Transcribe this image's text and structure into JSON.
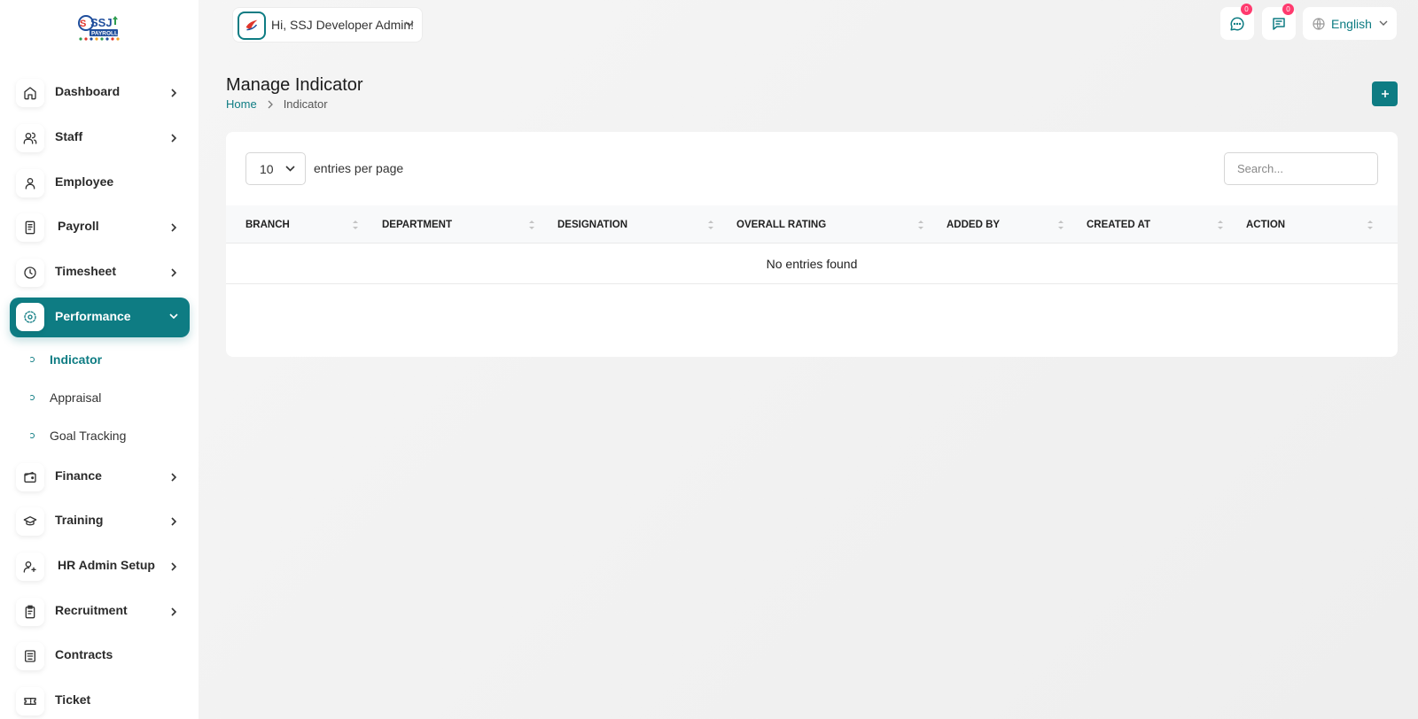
{
  "brand": {
    "logo_text": "SSJ PAYROLL",
    "accent": "#0e7c83"
  },
  "header": {
    "greeting": "Hi, SSJ Developer Admin!",
    "messages_badge": "0",
    "notifications_badge": "0",
    "language": "English"
  },
  "sidebar": {
    "items": [
      {
        "label": "Dashboard",
        "icon": "home-icon",
        "has_children": true
      },
      {
        "label": "Staff",
        "icon": "users-icon",
        "has_children": true
      },
      {
        "label": "Employee",
        "icon": "user-icon",
        "has_children": false
      },
      {
        "label": "Payroll",
        "icon": "receipt-icon",
        "has_children": true
      },
      {
        "label": "Timesheet",
        "icon": "clock-icon",
        "has_children": true
      },
      {
        "label": "Performance",
        "icon": "performance-icon",
        "has_children": true,
        "expanded": true
      },
      {
        "label": "Finance",
        "icon": "wallet-icon",
        "has_children": true
      },
      {
        "label": "Training",
        "icon": "graduation-cap-icon",
        "has_children": true
      },
      {
        "label": "HR Admin Setup",
        "icon": "user-plus-icon",
        "has_children": true
      },
      {
        "label": "Recruitment",
        "icon": "clipboard-icon",
        "has_children": true
      },
      {
        "label": "Contracts",
        "icon": "contract-icon",
        "has_children": false
      },
      {
        "label": "Ticket",
        "icon": "ticket-icon",
        "has_children": false
      }
    ],
    "subitems": [
      {
        "label": "Indicator",
        "active": true
      },
      {
        "label": "Appraisal",
        "active": false
      },
      {
        "label": "Goal Tracking",
        "active": false
      }
    ]
  },
  "page": {
    "title": "Manage Indicator",
    "breadcrumb": [
      "Home",
      "Indicator"
    ]
  },
  "table": {
    "per_page_value": "10",
    "per_page_label": "entries per page",
    "search_placeholder": "Search...",
    "columns": [
      "BRANCH",
      "DEPARTMENT",
      "DESIGNATION",
      "OVERALL RATING",
      "ADDED BY",
      "CREATED AT",
      "ACTION"
    ],
    "empty_message": "No entries found"
  }
}
